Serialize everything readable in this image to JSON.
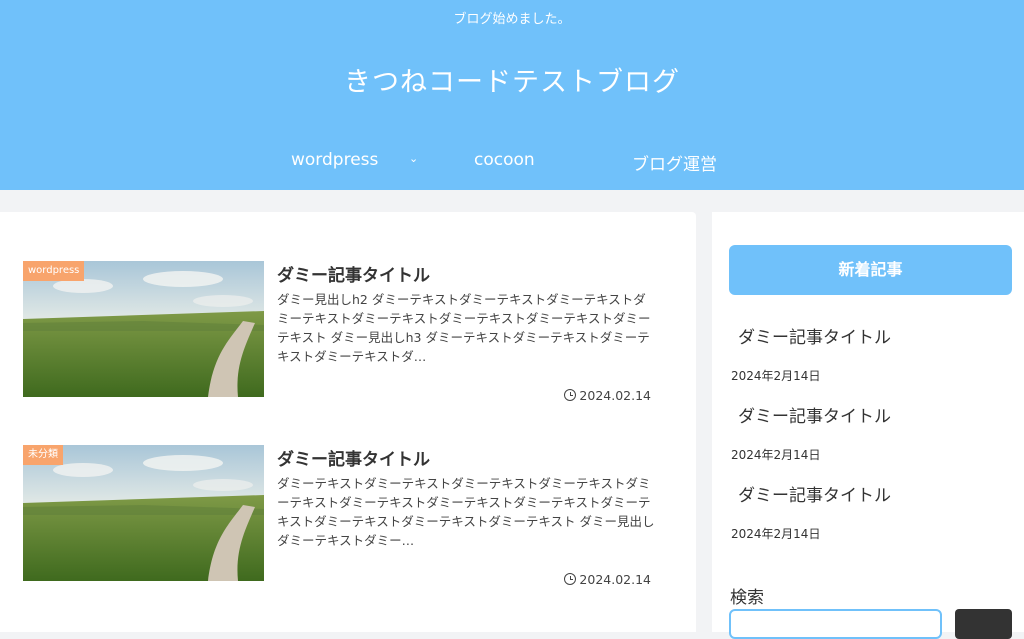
{
  "header": {
    "tagline": "ブログ始めました。",
    "site_title": "きつねコードテストブログ",
    "nav": [
      {
        "label": "wordpress"
      },
      {
        "label": "cocoon"
      },
      {
        "label": "ブログ運営"
      }
    ]
  },
  "posts": [
    {
      "category": "wordpress",
      "title": "ダミー記事タイトル",
      "snippet": "ダミー見出しh2 ダミーテキストダミーテキストダミーテキストダミーテキストダミーテキストダミーテキストダミーテキストダミーテキスト ダミー見出しh3 ダミーテキストダミーテキストダミーテキストダミーテキストダ…",
      "date": "2024.02.14"
    },
    {
      "category": "未分類",
      "title": "ダミー記事タイトル",
      "snippet": "ダミーテキストダミーテキストダミーテキストダミーテキストダミーテキストダミーテキストダミーテキストダミーテキストダミーテキストダミーテキストダミーテキストダミーテキスト ダミー見出し ダミーテキストダミー…",
      "date": "2024.02.14"
    }
  ],
  "sidebar": {
    "recent_heading": "新着記事",
    "recent": [
      {
        "title": "ダミー記事タイトル",
        "date": "2024年2月14日"
      },
      {
        "title": "ダミー記事タイトル",
        "date": "2024年2月14日"
      },
      {
        "title": "ダミー記事タイトル",
        "date": "2024年2月14日"
      }
    ],
    "search_heading": "検索"
  },
  "colors": {
    "header_bg": "#70c1fa",
    "category_label": "#f8a46c",
    "page_bg": "#f2f3f5"
  }
}
